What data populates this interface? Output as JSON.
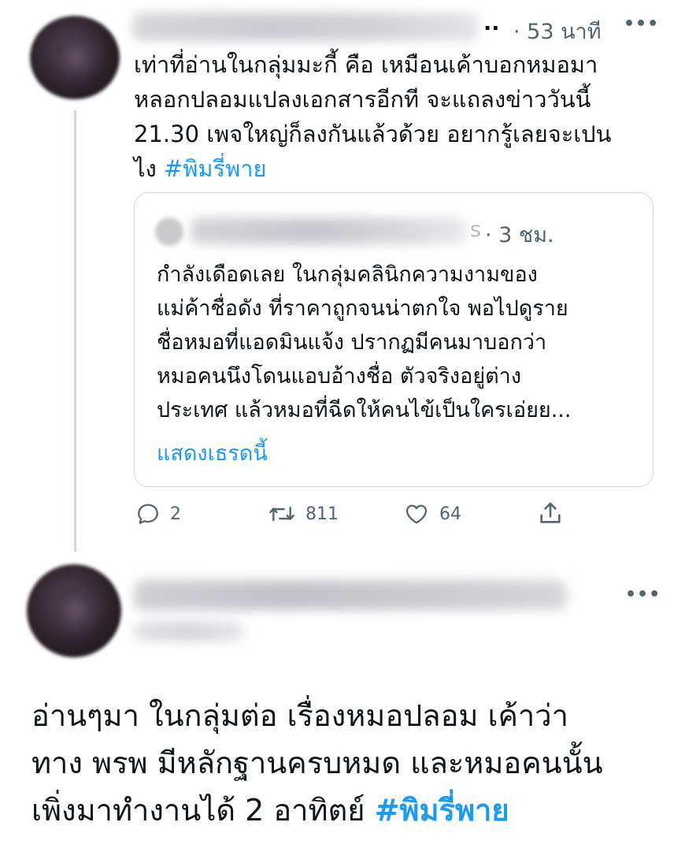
{
  "tweet1": {
    "display_name_suffix": "..",
    "time": "· 53 นาที",
    "more_icon": "more-horizontal-icon",
    "text": "เท่าที่อ่านในกลุ่มมะกี้ คือ เหมือนเค้าบอกหมอมา\nหลอกปลอมแปลงเอกสารอีกที จะแถลงข่าววันนี้\n21.30 เพจใหญ่ก็ลงกันแล้วด้วย อยากรู้เลยจะเปน\nไง ",
    "hashtag": "#พิมรี่พาย",
    "quote": {
      "handle_suffix": "s",
      "time": "· 3 ชม.",
      "text": "กำลังเดือดเลย ในกลุ่มคลินิกความงามของ\nแม่ค้าชื่อดัง ที่ราคาถูกจนน่าตกใจ พอไปดูราย\nชื่อหมอที่แอดมินแจ้ง ปรากฏมีคนมาบอกว่า\nหมอคนนึงโดนแอบอ้างชื่อ ตัวจริงอยู่ต่าง\nประเทศ แล้วหมอที่ฉีดให้คนไข้เป็นใครเอ่ยย...",
      "show_thread": "แสดงเธรดนี้"
    },
    "actions": {
      "reply_icon": "reply-icon",
      "reply_count": "2",
      "retweet_icon": "retweet-icon",
      "retweet_count": "811",
      "like_icon": "like-icon",
      "like_count": "64",
      "share_icon": "share-icon"
    }
  },
  "tweet2": {
    "more_icon": "more-horizontal-icon",
    "text": "อ่านๆมา ในกลุ่มต่อ เรื่องหมอปลอม เค้าว่า\nทาง พรพ มีหลักฐานครบหมด และหมอคนนั้น\nเพิ่งมาทำงานได้ 2 อาทิตย์ ",
    "hashtag": "#พิมรี่พาย"
  },
  "colors": {
    "accent": "#1d9bf0",
    "text": "#0f1419",
    "muted": "#536471",
    "border": "#cfd9de"
  }
}
